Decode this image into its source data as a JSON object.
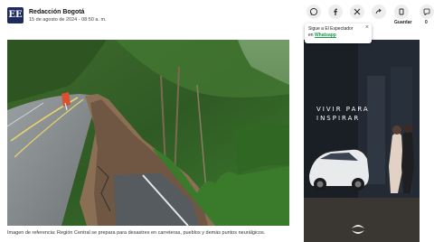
{
  "author": {
    "avatar_text": "EE",
    "name": "Redacción Bogotá",
    "date": "15 de agosto de 2024 - 08:50 a. m."
  },
  "share": {
    "icons": [
      "whatsapp-icon",
      "facebook-icon",
      "x-icon",
      "share-icon",
      "bookmark-icon",
      "comment-icon"
    ],
    "save_label": "Guardar",
    "comment_count": "0"
  },
  "popup": {
    "line1": "Sigue a El Espectador",
    "line2_prefix": "en ",
    "line2_link": "Whatsapp",
    "close": "×"
  },
  "article": {
    "caption": "Imagen de referencia: Región Central se prepara para desastres en carreteras, pueblos y demás puntos neurálgicos."
  },
  "ad": {
    "headline_line1": "VIVIR PARA",
    "headline_line2": "INSPIRAR"
  },
  "colors": {
    "avatar_bg": "#1d2b5c",
    "whatsapp_green": "#1a9c4a",
    "ad_bg": "#1a1f26"
  }
}
